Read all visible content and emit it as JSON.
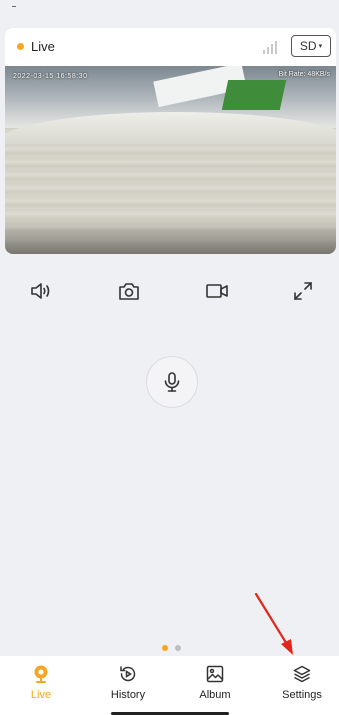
{
  "live_card": {
    "status_label": "Live",
    "quality_label": "SD",
    "quality_caret": "▾"
  },
  "video": {
    "timestamp": "2022-03-15  16:58:30",
    "bitrate": "Bit Rate: 48KB/s"
  },
  "controls": {
    "items": [
      "speaker-icon",
      "camera-icon",
      "video-record-icon",
      "fullscreen-icon"
    ]
  },
  "pager": {
    "count": 2,
    "active_index": 0
  },
  "tabbar": {
    "tabs": [
      {
        "label": "Live",
        "icon": "live-icon",
        "active": true
      },
      {
        "label": "History",
        "icon": "history-icon",
        "active": false
      },
      {
        "label": "Album",
        "icon": "album-icon",
        "active": false
      },
      {
        "label": "Settings",
        "icon": "settings-icon",
        "active": false
      }
    ]
  },
  "colors": {
    "accent": "#f6a623",
    "annotation_arrow": "#e2261c",
    "background": "#eff0f4"
  }
}
